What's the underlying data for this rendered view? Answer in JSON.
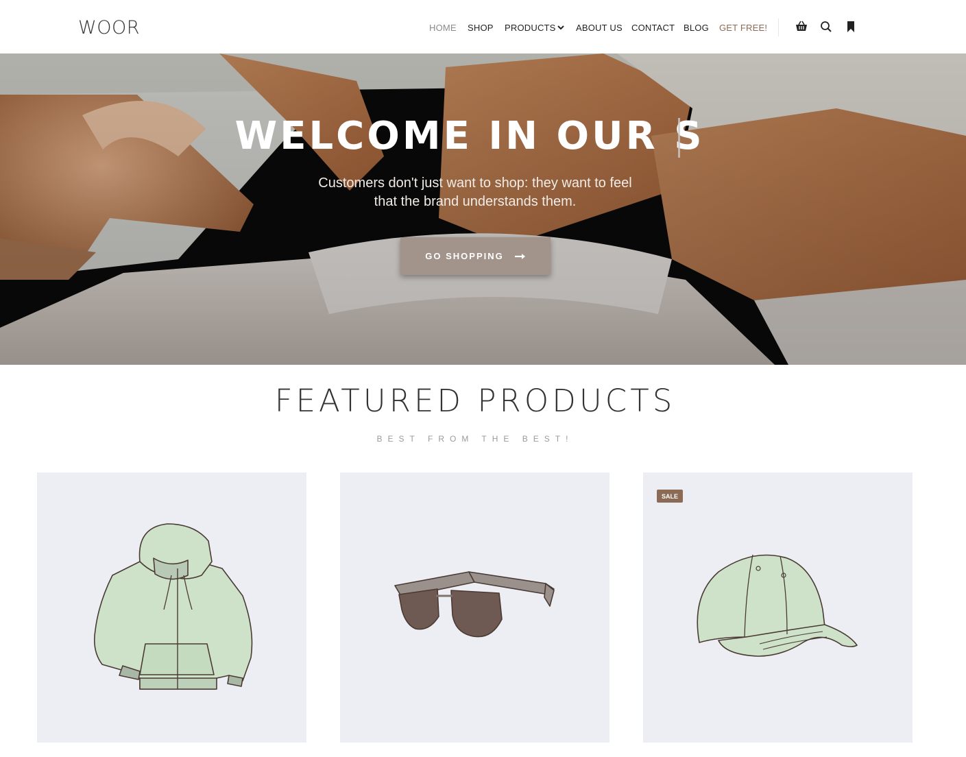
{
  "header": {
    "logo": "WOOR",
    "nav": {
      "home": "HOME",
      "shop": "SHOP",
      "products": "PRODUCTS",
      "about": "ABOUT US",
      "contact": "CONTACT",
      "blog": "BLOG",
      "get_free": "GET FREE!"
    },
    "icons": [
      "basket-icon",
      "search-icon",
      "bookmark-icon",
      "chevron-down-icon"
    ]
  },
  "hero": {
    "title": "WELCOME IN OUR S",
    "subtitle_line1": "Customers don't just want to shop: they want to feel",
    "subtitle_line2": "that the brand understands them.",
    "button_label": "GO SHOPPING"
  },
  "featured": {
    "title": "FEATURED PRODUCTS",
    "subtitle": "BEST FROM THE BEST!",
    "products": [
      {
        "image": "hoodie-image"
      },
      {
        "image": "sunglasses-image"
      },
      {
        "image": "cap-image",
        "badge": "SALE"
      }
    ]
  },
  "colors": {
    "brand": "#8b6b55",
    "button": "#a2938b",
    "card_bg": "#eceef3",
    "item_green": "#cde2c9"
  }
}
